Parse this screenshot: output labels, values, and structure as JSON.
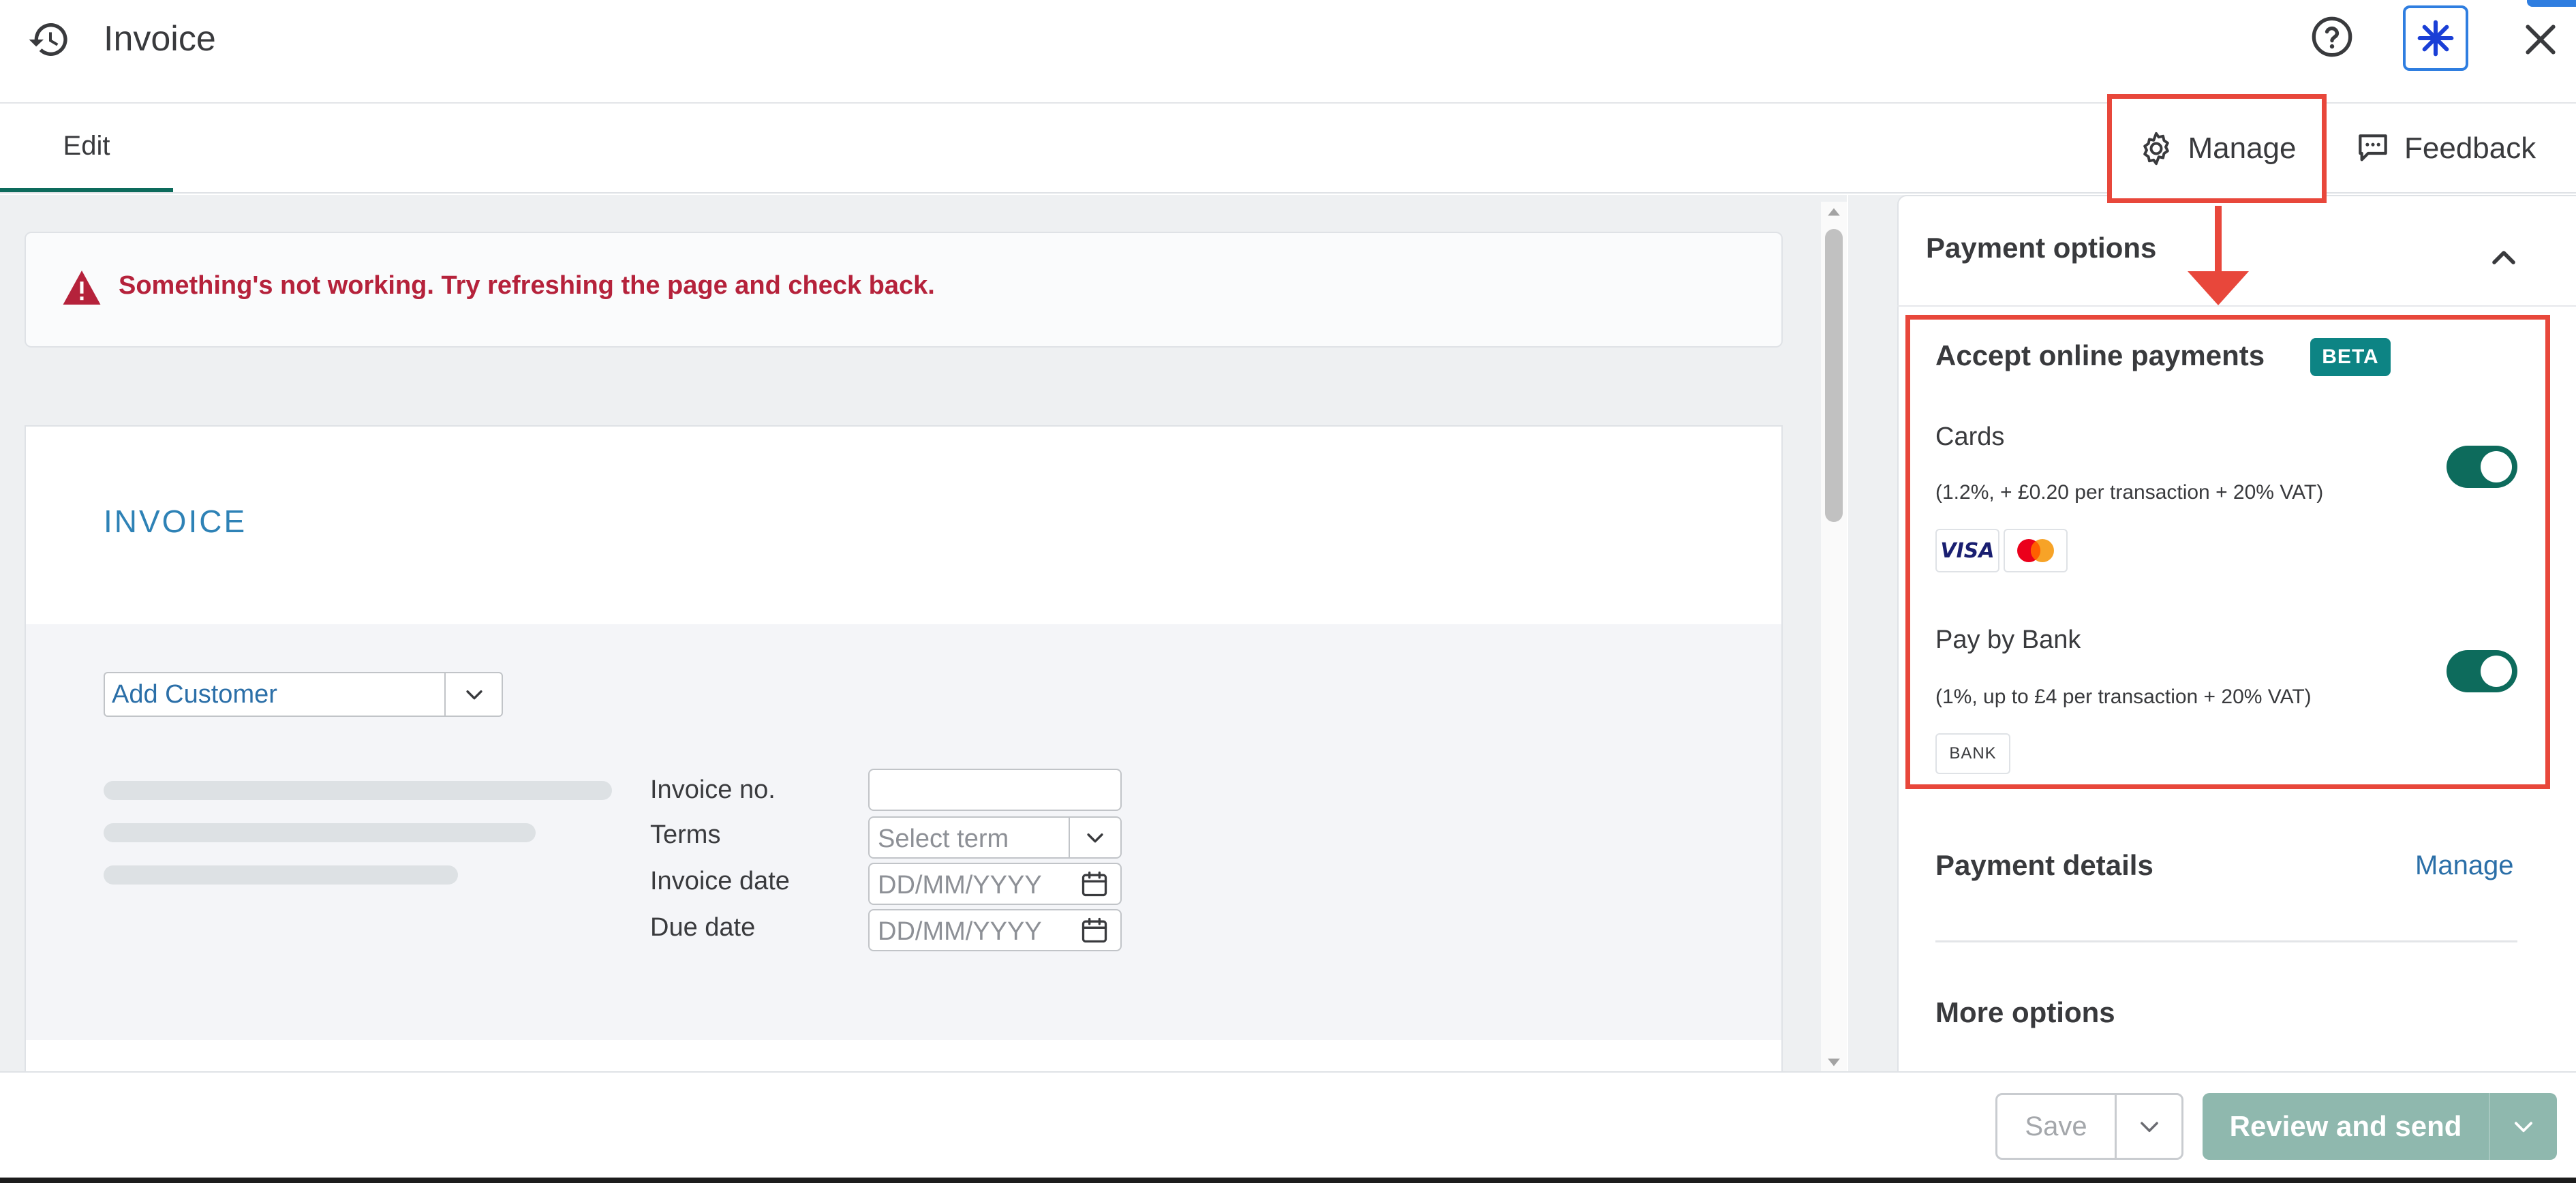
{
  "header": {
    "title": "Invoice"
  },
  "tabs": {
    "edit_label": "Edit"
  },
  "toolbar": {
    "manage_label": "Manage",
    "feedback_label": "Feedback"
  },
  "alert": {
    "message": "Something's not working. Try refreshing the page and check back."
  },
  "invoice": {
    "title": "INVOICE",
    "customer_value": "Add Customer",
    "fields": {
      "invoice_no_label": "Invoice no.",
      "terms_label": "Terms",
      "terms_placeholder": "Select term",
      "invoice_date_label": "Invoice date",
      "invoice_date_placeholder": "DD/MM/YYYY",
      "due_date_label": "Due date",
      "due_date_placeholder": "DD/MM/YYYY"
    }
  },
  "payment_panel": {
    "title": "Payment options",
    "accept_online": {
      "title": "Accept online payments",
      "badge": "BETA"
    },
    "cards": {
      "label": "Cards",
      "description": "(1.2%, + £0.20 per transaction + 20% VAT)",
      "enabled": true,
      "visa_text": "VISA"
    },
    "bank": {
      "label": "Pay by Bank",
      "description": "(1%, up to £4 per transaction + 20% VAT)",
      "enabled": true,
      "logo_text": "BANK"
    },
    "payment_details": {
      "title": "Payment details",
      "manage_link": "Manage"
    },
    "more_options": {
      "title": "More options"
    }
  },
  "footer": {
    "save_label": "Save",
    "review_label": "Review and send"
  },
  "colors": {
    "accent_green": "#0d6b5c",
    "link_blue": "#2b6fa8",
    "alert_red": "#b5223b",
    "highlight_red": "#e8473b",
    "beta_teal": "#0d8484"
  }
}
